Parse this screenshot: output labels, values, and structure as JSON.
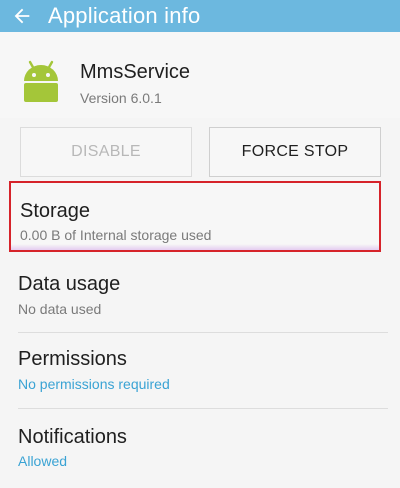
{
  "appbar": {
    "title": "Application info",
    "back_icon": "arrow-left-icon"
  },
  "app": {
    "icon": "android-icon",
    "name": "MmsService",
    "version": "Version 6.0.1"
  },
  "buttons": {
    "disable_label": "DISABLE",
    "force_stop_label": "FORCE STOP"
  },
  "items": [
    {
      "title": "Storage",
      "subtitle": "0.00 B of Internal storage used"
    },
    {
      "title": "Data usage",
      "subtitle": "No data used"
    },
    {
      "title": "Permissions",
      "subtitle": "No permissions required"
    },
    {
      "title": "Notifications",
      "subtitle": "Allowed"
    }
  ],
  "colors": {
    "appbar": "#6cb8df",
    "accent": "#3aa3d4",
    "highlight_border": "#d6232a",
    "android_green": "#a4c639"
  }
}
